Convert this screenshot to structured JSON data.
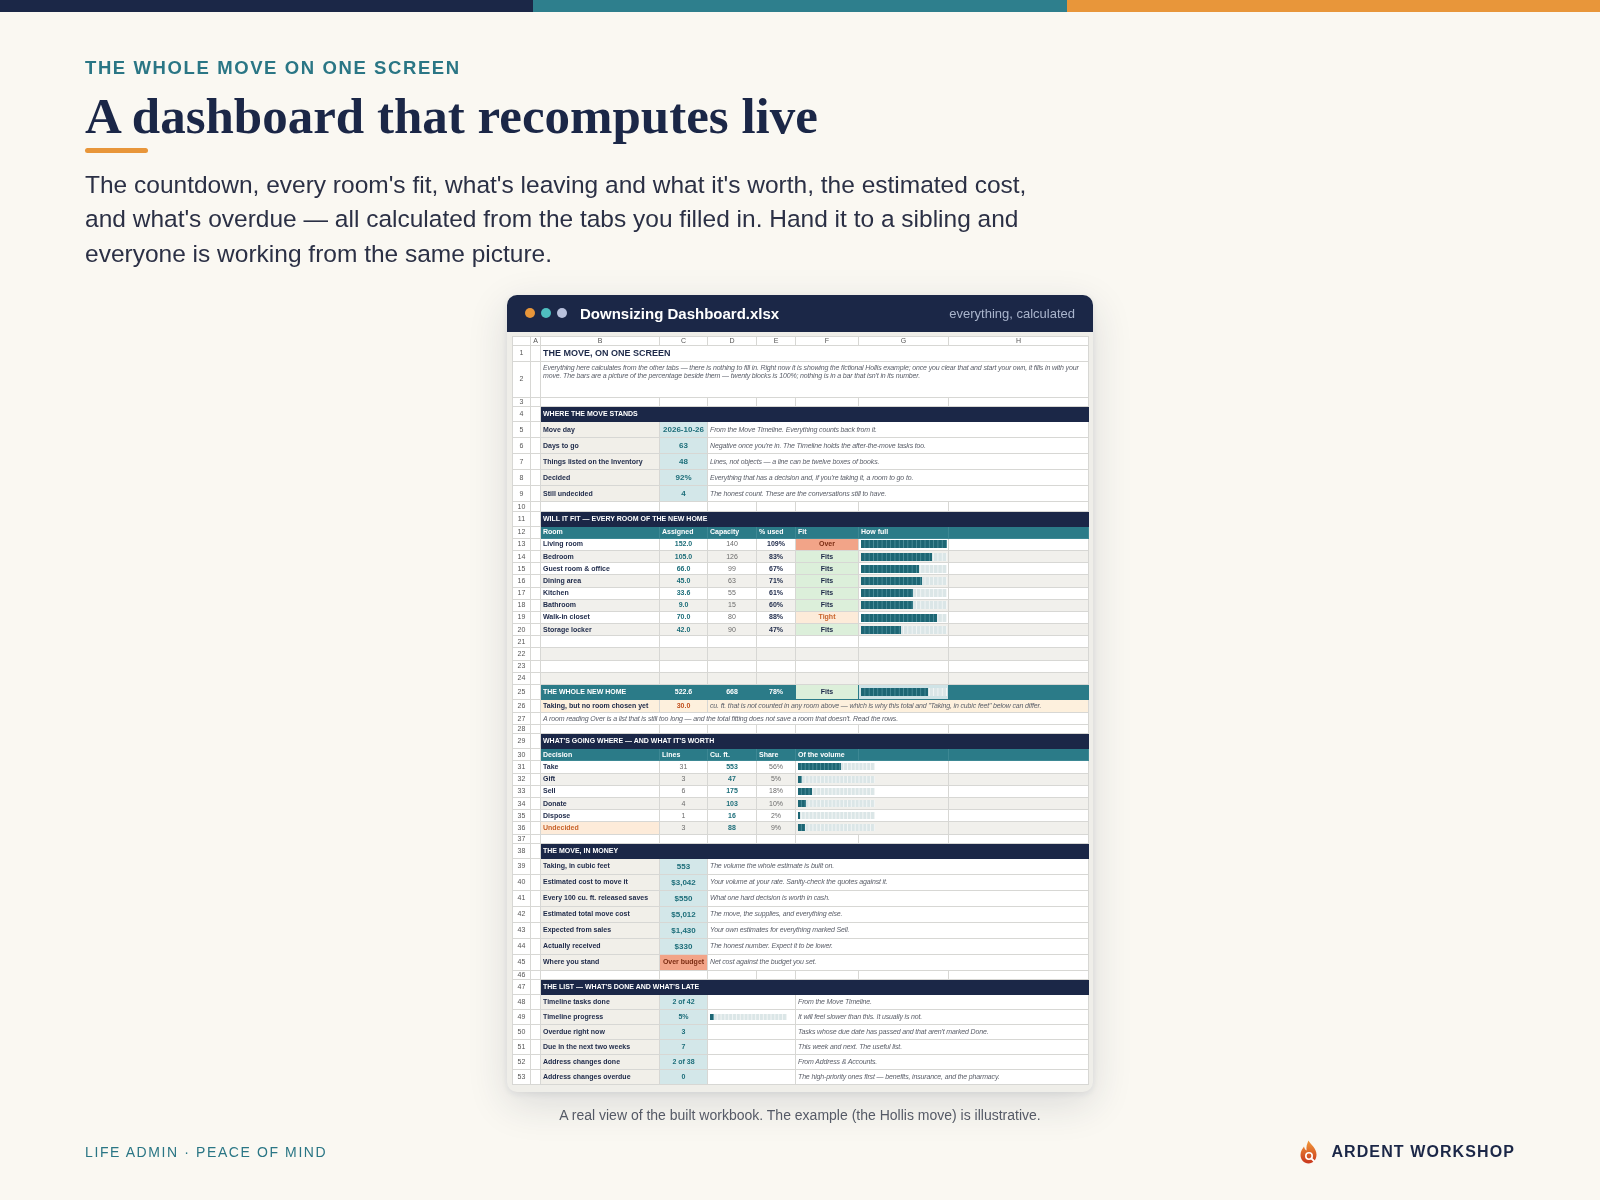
{
  "header": {
    "eyebrow": "THE WHOLE MOVE ON ONE SCREEN",
    "title": "A dashboard that recomputes live",
    "intro": "The countdown, every room's fit, what's leaving and what it's worth, the estimated cost, and what's overdue — all calculated from the tabs you filled in. Hand it to a sibling and everyone is working from the same picture."
  },
  "window": {
    "title": "Downsizing Dashboard.xlsx",
    "subtitle": "everything, calculated"
  },
  "sheet": {
    "columns": [
      "A",
      "B",
      "C",
      "D",
      "E",
      "F",
      "G",
      "H"
    ],
    "rows": [
      {
        "number": "1",
        "kind": "title",
        "text": "THE MOVE, ON ONE SCREEN"
      },
      {
        "number": "2",
        "kind": "intro",
        "text": "Everything here calculates from the other tabs — there is nothing to fill in. Right now it is showing the fictional Hollis example; once you clear that and start your own, it fills in with your move. The bars are a picture of the percentage beside them — twenty blocks is 100%; nothing is in a bar that isn't in its number."
      },
      {
        "number": "3",
        "kind": "spacer"
      },
      {
        "number": "4",
        "kind": "section",
        "text": "WHERE THE MOVE STANDS"
      },
      {
        "number": "5",
        "kind": "stat",
        "label": "Move day",
        "value": "2026-10-26",
        "note": "From the Move Timeline. Everything counts back from it.",
        "alert": false
      },
      {
        "number": "6",
        "kind": "stat",
        "label": "Days to go",
        "value": "63",
        "note": "Negative once you're in. The Timeline holds the after-the-move tasks too.",
        "alert": false
      },
      {
        "number": "7",
        "kind": "stat",
        "label": "Things listed on the Inventory",
        "value": "48",
        "note": "Lines, not objects — a line can be twelve boxes of books.",
        "alert": false
      },
      {
        "number": "8",
        "kind": "stat",
        "label": "Decided",
        "value": "92%",
        "note": "Everything that has a decision and, if you're taking it, a room to go to.",
        "alert": false
      },
      {
        "number": "9",
        "kind": "stat",
        "label": "Still undecided",
        "value": "4",
        "note": "The honest count. These are the conversations still to have.",
        "alert": false
      },
      {
        "number": "10",
        "kind": "spacer"
      },
      {
        "number": "11",
        "kind": "section",
        "text": "WILL IT FIT — EVERY ROOM OF THE NEW HOME"
      },
      {
        "number": "12",
        "kind": "table_head",
        "labels": [
          "Room",
          "Assigned",
          "Capacity",
          "% used",
          "Fit",
          "How full"
        ]
      },
      {
        "number": "13",
        "kind": "room",
        "room": "Living room",
        "assigned": "152.0",
        "capacity": "140",
        "used": "109%",
        "fit": "Over",
        "color": "#f2a488",
        "level": 1,
        "shaded": false
      },
      {
        "number": "14",
        "kind": "room",
        "room": "Bedroom",
        "assigned": "105.0",
        "capacity": "126",
        "used": "83%",
        "fit": "Fits",
        "color": "#dcefda",
        "level": 0.83,
        "shaded": true
      },
      {
        "number": "15",
        "kind": "room",
        "room": "Guest room & office",
        "assigned": "66.0",
        "capacity": "99",
        "used": "67%",
        "fit": "Fits",
        "color": "#dcefda",
        "level": 0.67,
        "shaded": false
      },
      {
        "number": "16",
        "kind": "room",
        "room": "Dining area",
        "assigned": "45.0",
        "capacity": "63",
        "used": "71%",
        "fit": "Fits",
        "color": "#dcefda",
        "level": 0.71,
        "shaded": true
      },
      {
        "number": "17",
        "kind": "room",
        "room": "Kitchen",
        "assigned": "33.6",
        "capacity": "55",
        "used": "61%",
        "fit": "Fits",
        "color": "#dcefda",
        "level": 0.61,
        "shaded": false
      },
      {
        "number": "18",
        "kind": "room",
        "room": "Bathroom",
        "assigned": "9.0",
        "capacity": "15",
        "used": "60%",
        "fit": "Fits",
        "color": "#dcefda",
        "level": 0.6,
        "shaded": true
      },
      {
        "number": "19",
        "kind": "room",
        "room": "Walk-in closet",
        "assigned": "70.0",
        "capacity": "80",
        "used": "88%",
        "fit": "Tight",
        "color": "#fdebd9",
        "level": 0.88,
        "shaded": false
      },
      {
        "number": "20",
        "kind": "room",
        "room": "Storage locker",
        "assigned": "42.0",
        "capacity": "90",
        "used": "47%",
        "fit": "Fits",
        "color": "#dcefda",
        "level": 0.47,
        "shaded": true
      },
      {
        "number": "21",
        "kind": "empty",
        "shaded": false
      },
      {
        "number": "22",
        "kind": "empty",
        "shaded": true
      },
      {
        "number": "23",
        "kind": "empty",
        "shaded": false
      },
      {
        "number": "24",
        "kind": "empty",
        "shaded": true
      },
      {
        "number": "25",
        "kind": "total",
        "label": "THE WHOLE NEW HOME",
        "assigned": "522.6",
        "capacity": "668",
        "used": "78%",
        "fit": "Fits",
        "color": "#dcefda",
        "level": 0.78
      },
      {
        "number": "26",
        "kind": "callout",
        "label": "Taking, but no room chosen yet",
        "value": "30.0",
        "note": "cu. ft. that is not counted in any room above — which is why this total and \"Taking, in cubic feet\" below can differ."
      },
      {
        "number": "27",
        "kind": "note",
        "text": "A room reading Over is a list that is still too long — and the total fitting does not save a room that doesn't. Read the rows."
      },
      {
        "number": "28",
        "kind": "spacer"
      },
      {
        "number": "29",
        "kind": "section",
        "text": "WHAT'S GOING WHERE — AND WHAT IT'S WORTH"
      },
      {
        "number": "30",
        "kind": "table_head",
        "labels": [
          "Decision",
          "Lines",
          "Cu. ft.",
          "Share",
          "Of the volume"
        ]
      },
      {
        "number": "31",
        "kind": "decision",
        "decision": "Take",
        "lines": "31",
        "cuft": "553",
        "share": "56%",
        "level": 0.56,
        "shaded": false,
        "highlight": false
      },
      {
        "number": "32",
        "kind": "decision",
        "decision": "Gift",
        "lines": "3",
        "cuft": "47",
        "share": "5%",
        "level": 0.05,
        "shaded": true,
        "highlight": false
      },
      {
        "number": "33",
        "kind": "decision",
        "decision": "Sell",
        "lines": "6",
        "cuft": "175",
        "share": "18%",
        "level": 0.18,
        "shaded": false,
        "highlight": false
      },
      {
        "number": "34",
        "kind": "decision",
        "decision": "Donate",
        "lines": "4",
        "cuft": "103",
        "share": "10%",
        "level": 0.1,
        "shaded": true,
        "highlight": false
      },
      {
        "number": "35",
        "kind": "decision",
        "decision": "Dispose",
        "lines": "1",
        "cuft": "16",
        "share": "2%",
        "level": 0.02,
        "shaded": false,
        "highlight": false
      },
      {
        "number": "36",
        "kind": "decision",
        "decision": "Undecided",
        "lines": "3",
        "cuft": "88",
        "share": "9%",
        "level": 0.09,
        "shaded": true,
        "highlight": true
      },
      {
        "number": "37",
        "kind": "spacer"
      },
      {
        "number": "38",
        "kind": "section",
        "text": "THE MOVE, IN MONEY"
      },
      {
        "number": "39",
        "kind": "stat",
        "label": "Taking, in cubic feet",
        "value": "553",
        "note": "The volume the whole estimate is built on.",
        "alert": false
      },
      {
        "number": "40",
        "kind": "stat",
        "label": "Estimated cost to move it",
        "value": "$3,042",
        "note": "Your volume at your rate. Sanity-check the quotes against it.",
        "alert": false
      },
      {
        "number": "41",
        "kind": "stat",
        "label": "Every 100 cu. ft. released saves",
        "value": "$550",
        "note": "What one hard decision is worth in cash.",
        "alert": false
      },
      {
        "number": "42",
        "kind": "stat",
        "label": "Estimated total move cost",
        "value": "$5,012",
        "note": "The move, the supplies, and everything else.",
        "alert": false
      },
      {
        "number": "43",
        "kind": "stat",
        "label": "Expected from sales",
        "value": "$1,430",
        "note": "Your own estimates for everything marked Sell.",
        "alert": false
      },
      {
        "number": "44",
        "kind": "stat",
        "label": "Actually received",
        "value": "$330",
        "note": "The honest number. Expect it to be lower.",
        "alert": false
      },
      {
        "number": "45",
        "kind": "stat",
        "label": "Where you stand",
        "value": "Over budget",
        "note": "Net cost against the budget you set.",
        "alert": true
      },
      {
        "number": "46",
        "kind": "spacer"
      },
      {
        "number": "47",
        "kind": "section",
        "text": "THE LIST — WHAT'S DONE AND WHAT'S LATE"
      },
      {
        "number": "48",
        "kind": "task",
        "label": "Timeline tasks done",
        "value": "2 of 42",
        "note": "From the Move Timeline."
      },
      {
        "number": "49",
        "kind": "task",
        "label": "Timeline progress",
        "value": "5%",
        "level": 0.05,
        "note": "It will feel slower than this. It usually is not."
      },
      {
        "number": "50",
        "kind": "task",
        "label": "Overdue right now",
        "value": "3",
        "note": "Tasks whose due date has passed and that aren't marked Done."
      },
      {
        "number": "51",
        "kind": "task",
        "label": "Due in the next two weeks",
        "value": "7",
        "note": "This week and next. The useful list."
      },
      {
        "number": "52",
        "kind": "task",
        "label": "Address changes done",
        "value": "2 of 38",
        "note": "From Address & Accounts."
      },
      {
        "number": "53",
        "kind": "task",
        "label": "Address changes overdue",
        "value": "0",
        "note": "The high-priority ones first — benefits, insurance, and the pharmacy."
      }
    ]
  },
  "caption": "A real view of the built workbook. The example (the Hollis move) is illustrative.",
  "footer": {
    "tagline": "LIFE ADMIN · PEACE OF MIND",
    "brand": "ARDENT WORKSHOP"
  }
}
